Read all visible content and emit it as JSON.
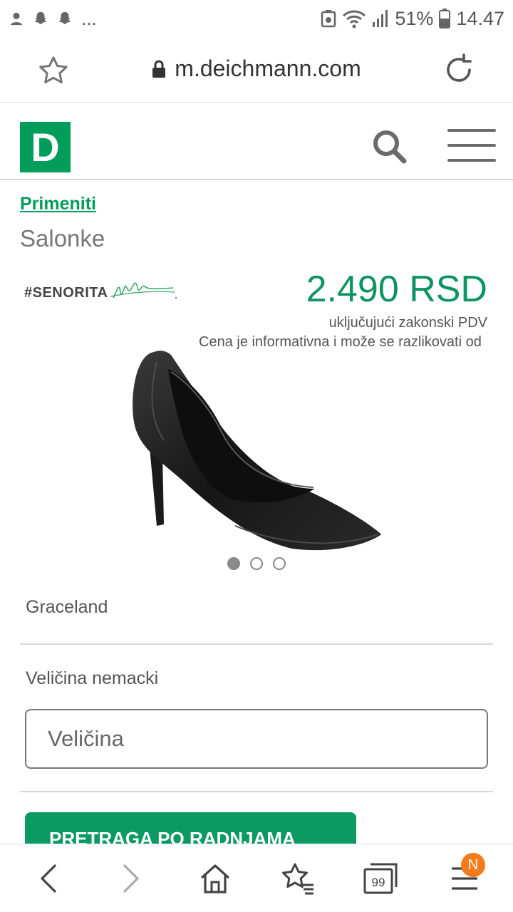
{
  "status_bar": {
    "more": "...",
    "battery_percent": "51%",
    "time": "14.47"
  },
  "browser": {
    "url": "m.deichmann.com"
  },
  "site": {
    "logo_letter": "D"
  },
  "product": {
    "breadcrumb": "Primeniti",
    "category": "Salonke",
    "brand": "#SENORITA",
    "price": "2.490 RSD",
    "vat_note": "uključujući zakonski PDV",
    "price_notice": "Cena je informativna i može se razlikovati od",
    "vendor": "Graceland",
    "size_label": "Veličina nemacki",
    "size_placeholder": "Veličina",
    "store_search_button": "PRETRAGA PO RADNJAMA",
    "carousel": {
      "total": 3,
      "active": 1
    }
  },
  "bottom_nav": {
    "tabs_count": "99",
    "badge": "N"
  },
  "colors": {
    "brand_green": "#009c5a",
    "badge_orange": "#f47a1a"
  }
}
